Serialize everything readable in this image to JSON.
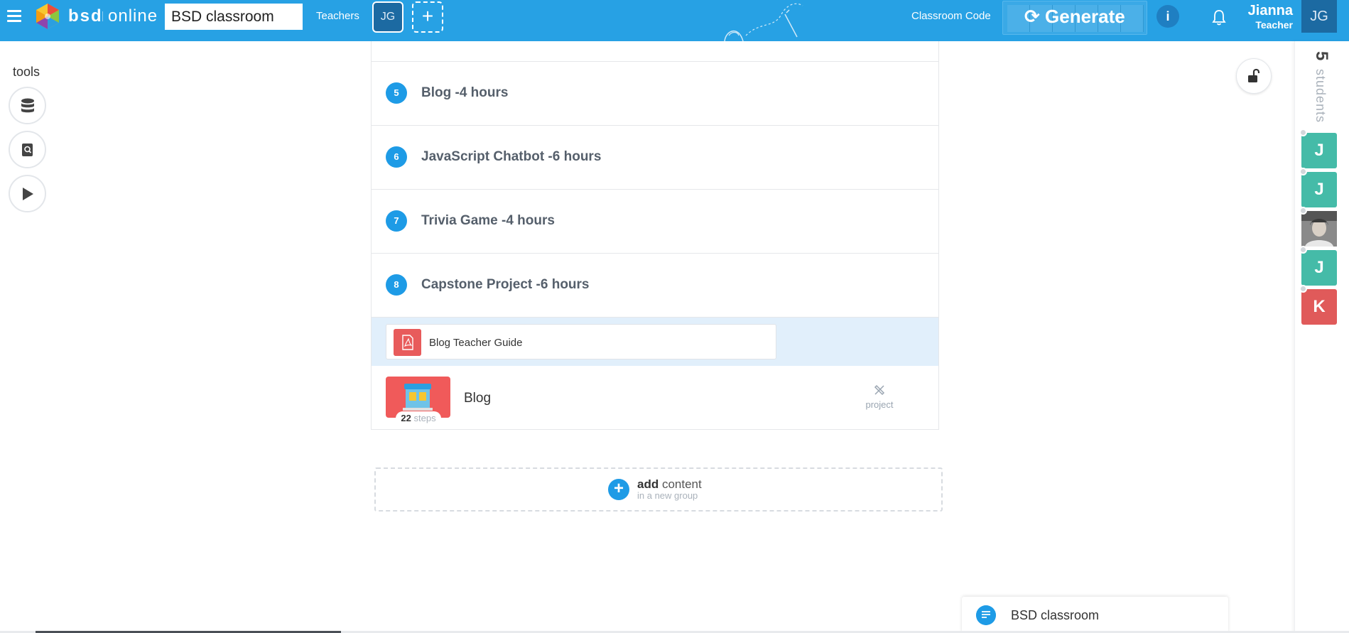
{
  "header": {
    "brand_name": "bsd",
    "brand_sub": "online",
    "classroom_name": "BSD classroom",
    "teachers_label": "Teachers",
    "teacher_initials": "JG",
    "add_teacher_symbol": "+",
    "classroom_code_label": "Classroom Code",
    "generate_label": "Generate",
    "info_symbol": "i",
    "user_name": "Jianna",
    "user_role": "Teacher",
    "user_initials": "JG",
    "colors": {
      "bar": "#27a1e4",
      "avatar": "#1c6aa2"
    },
    "icons": [
      "menu-icon",
      "bsd-logo",
      "refresh-icon",
      "info-icon",
      "bell-icon"
    ]
  },
  "tools": {
    "label": "tools",
    "items": [
      {
        "name": "database-icon"
      },
      {
        "name": "book-search-icon"
      },
      {
        "name": "play-icon"
      }
    ]
  },
  "units": [
    {
      "number": "5",
      "title": "Blog -4 hours"
    },
    {
      "number": "6",
      "title": "JavaScript Chatbot -6 hours"
    },
    {
      "number": "7",
      "title": "Trivia Game -4 hours"
    },
    {
      "number": "8",
      "title": "Capstone Project -6 hours"
    }
  ],
  "resource": {
    "title": "Blog Teacher Guide",
    "icon": "pdf-icon"
  },
  "project": {
    "title": "Blog",
    "steps_count": "22",
    "steps_unit": "steps",
    "tag": "project",
    "tag_icon": "tools-icon"
  },
  "add_content": {
    "symbol": "+",
    "bold": "add",
    "rest": "content",
    "subtext": "in a new group"
  },
  "students": {
    "count": "5",
    "label": "students",
    "lock_icon": "unlock-icon",
    "list": [
      {
        "initial": "J",
        "color": "#45bba8",
        "photo": false
      },
      {
        "initial": "J",
        "color": "#45bba8",
        "photo": false
      },
      {
        "initial": "",
        "color": "#666666",
        "photo": true
      },
      {
        "initial": "J",
        "color": "#45bba8",
        "photo": false
      },
      {
        "initial": "K",
        "color": "#e05a5a",
        "photo": false
      }
    ]
  },
  "chat": {
    "title": "BSD classroom",
    "icon": "chat-icon"
  }
}
